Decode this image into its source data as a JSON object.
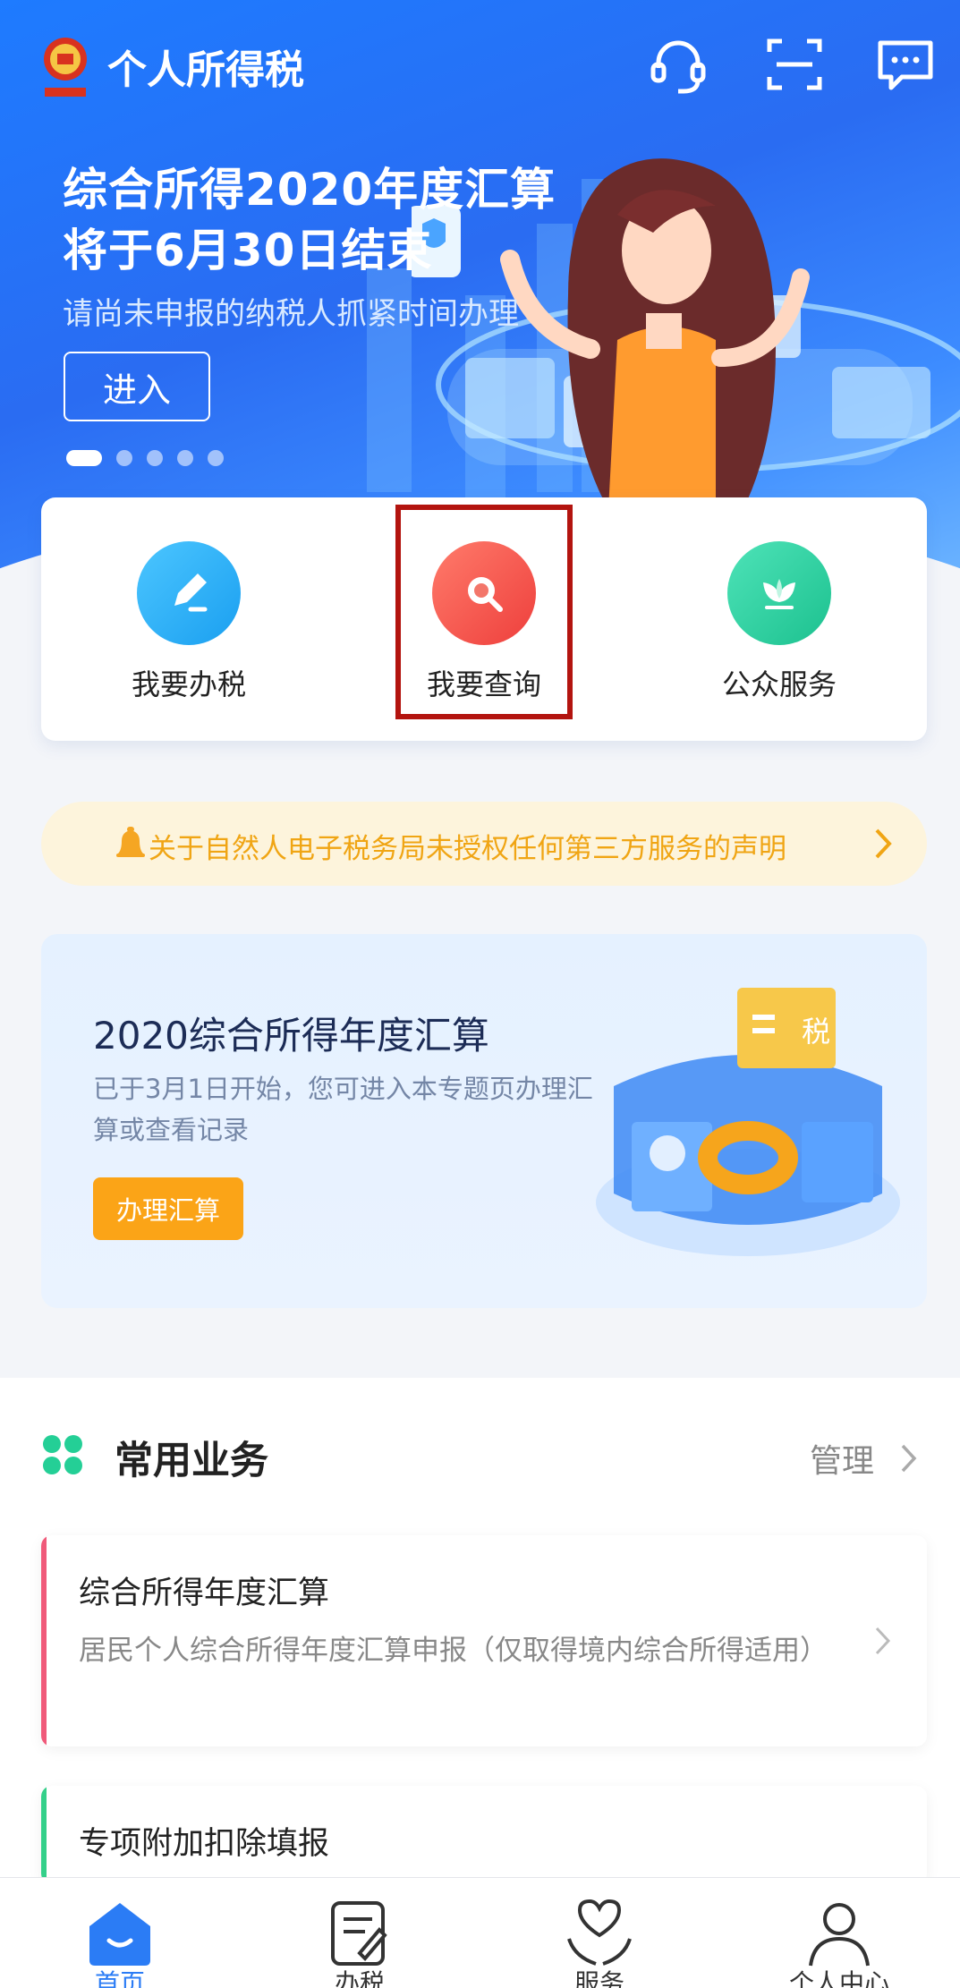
{
  "header": {
    "app_title": "个人所得税",
    "icons": [
      "headset-icon",
      "scan-icon",
      "message-icon"
    ]
  },
  "banner": {
    "title_line1": "综合所得2020年度汇算",
    "title_line2": "将于6月30日结束",
    "subtitle": "请尚未申报的纳税人抓紧时间办理",
    "button_label": "进入",
    "dots_count": 5,
    "active_dot": 0
  },
  "quick_actions": [
    {
      "label": "我要办税",
      "icon": "pen-icon",
      "color": "#2bb3f5"
    },
    {
      "label": "我要查询",
      "icon": "magnifier-icon",
      "color": "#f2504a"
    },
    {
      "label": "公众服务",
      "icon": "plant-icon",
      "color": "#27cf9f"
    }
  ],
  "notice": {
    "text": "关于自然人电子税务局未授权任何第三方服务的声明"
  },
  "annual_card": {
    "title": "2020综合所得年度汇算",
    "description": "已于3月1日开始，您可进入本专题页办理汇算或查看记录",
    "button_label": "办理汇算",
    "illustration_text": "税"
  },
  "common_section": {
    "title": "常用业务",
    "manage_label": "管理",
    "items": [
      {
        "title": "综合所得年度汇算",
        "description": "居民个人综合所得年度汇算申报（仅取得境内综合所得适用）",
        "bar_color": "#f05a7a"
      },
      {
        "title": "专项附加扣除填报",
        "description": "",
        "bar_color": "#34d08a"
      }
    ]
  },
  "bottom_nav": [
    {
      "label": "首页",
      "icon": "home-icon",
      "active": true
    },
    {
      "label": "办税",
      "icon": "document-icon",
      "active": false
    },
    {
      "label": "服务",
      "icon": "heart-hands-icon",
      "active": false
    },
    {
      "label": "个人中心",
      "icon": "user-icon",
      "active": false
    }
  ],
  "colors": {
    "primary": "#2b7cf5",
    "accent_orange": "#fba417",
    "highlight_border": "#b3140f"
  }
}
